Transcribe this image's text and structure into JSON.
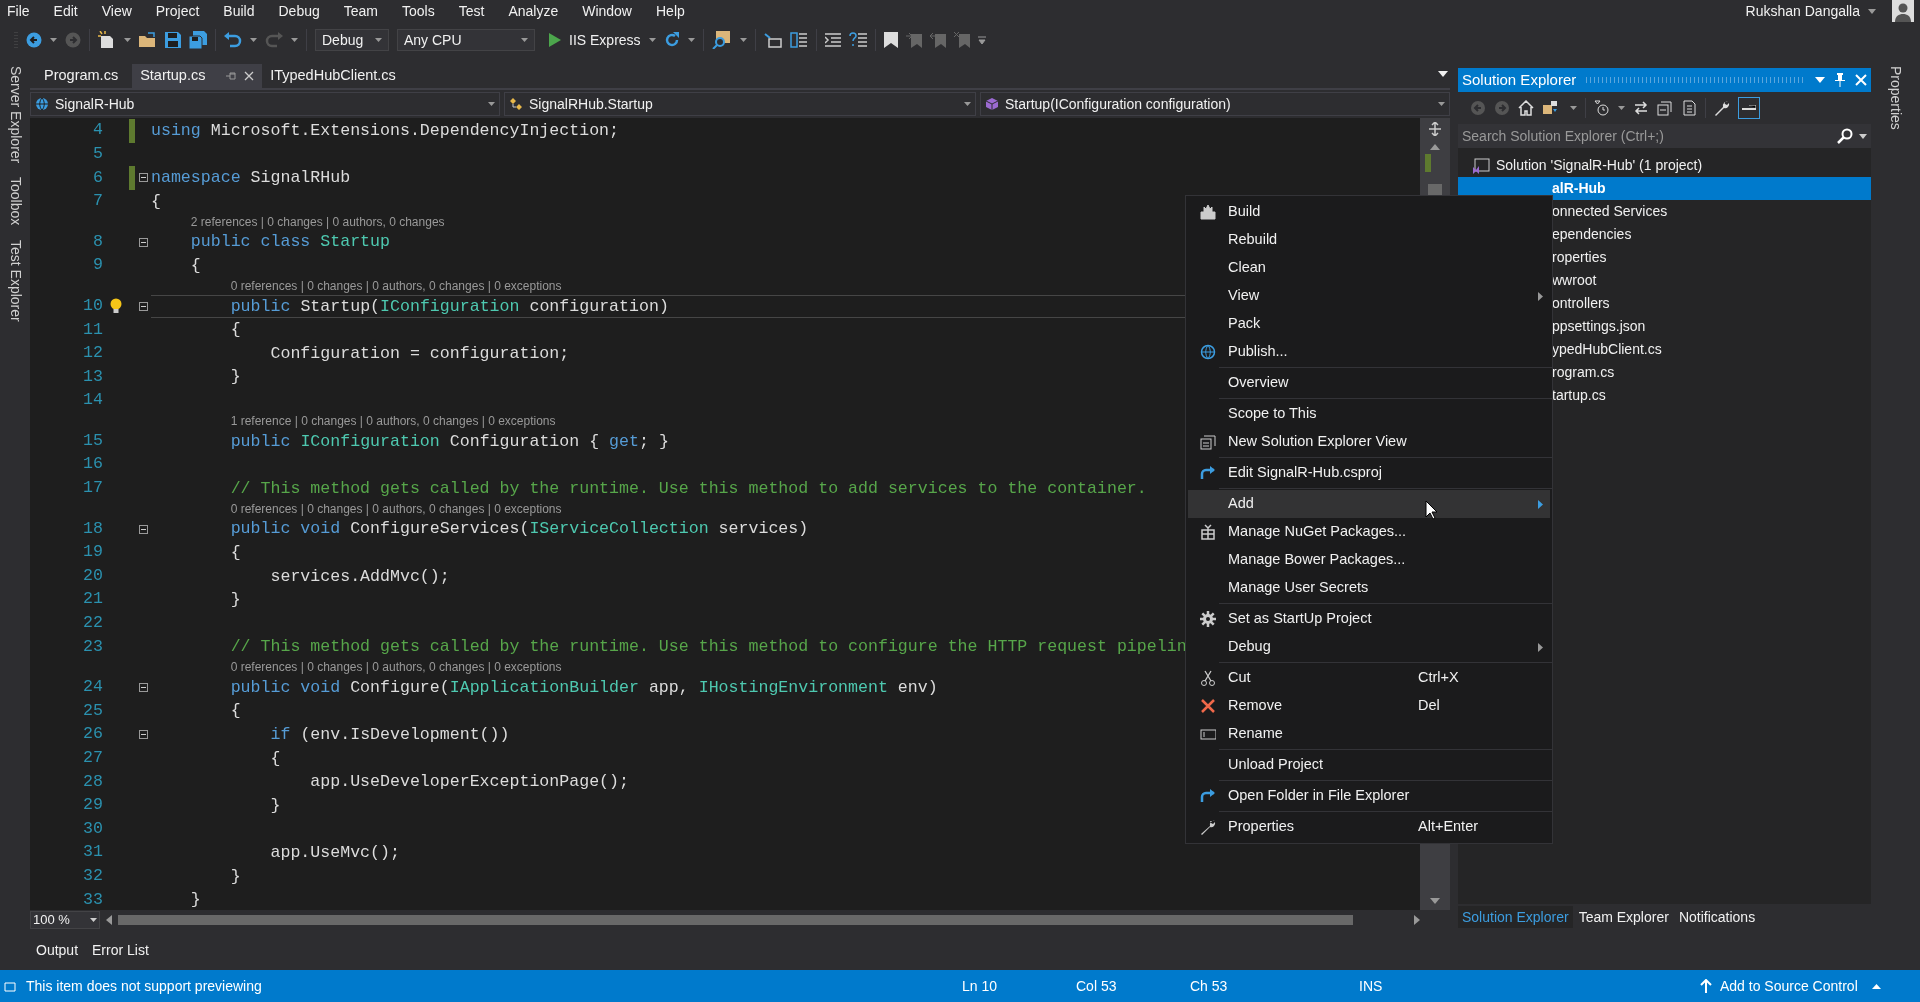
{
  "menu_bar": [
    "File",
    "Edit",
    "View",
    "Project",
    "Build",
    "Debug",
    "Team",
    "Tools",
    "Test",
    "Analyze",
    "Window",
    "Help"
  ],
  "user": {
    "name": "Rukshan Dangalla"
  },
  "toolbar": {
    "configuration": "Debug",
    "platform": "Any CPU",
    "run_target": "IIS Express"
  },
  "side_tabs_left": [
    "Server Explorer",
    "Toolbox",
    "Test Explorer"
  ],
  "side_tabs_right": [
    "Properties"
  ],
  "editor_tabs": [
    {
      "label": "Program.cs",
      "selected": false
    },
    {
      "label": "Startup.cs",
      "selected": true
    },
    {
      "label": "ITypedHubClient.cs",
      "selected": false
    }
  ],
  "navigation_bar": {
    "project": "SignalR-Hub",
    "type": "SignalRHub.Startup",
    "member": "Startup(IConfiguration configuration)"
  },
  "code": {
    "lines": [
      {
        "number": "4",
        "current": false,
        "changed": true,
        "fold": false,
        "tokens": [
          {
            "kind": "keyword",
            "text": "using"
          },
          {
            "kind": "plain",
            "text": " Microsoft.Extensions.DependencyInjection;"
          }
        ]
      },
      {
        "number": "5",
        "current": false,
        "changed": false,
        "fold": false
      },
      {
        "number": "6",
        "current": false,
        "changed": true,
        "fold": true,
        "tokens": [
          {
            "kind": "keyword",
            "text": "namespace"
          },
          {
            "kind": "plain",
            "text": " SignalRHub"
          }
        ]
      },
      {
        "number": "7",
        "current": false,
        "changed": false,
        "fold": false,
        "tokens": [
          {
            "kind": "plain",
            "text": "{"
          }
        ]
      },
      {
        "number": "8",
        "current": false,
        "changed": false,
        "fold": true,
        "codelens": "2 references | 0 changes | 0 authors, 0 changes",
        "tokens": [
          {
            "kind": "keyword",
            "text": "    public class"
          },
          {
            "kind": "type",
            "text": " Startup"
          }
        ]
      },
      {
        "number": "9",
        "current": false,
        "changed": false,
        "fold": false,
        "tokens": [
          {
            "kind": "plain",
            "text": "    {"
          }
        ]
      },
      {
        "number": "10",
        "current": true,
        "changed": false,
        "fold": true,
        "codelens": "0 references | 0 changes | 0 authors, 0 changes | 0 exceptions",
        "tokens": [
          {
            "kind": "keyword",
            "text": "        public"
          },
          {
            "kind": "plain",
            "text": " Startup("
          },
          {
            "kind": "type",
            "text": "IConfiguration"
          },
          {
            "kind": "plain",
            "text": " configuration)"
          }
        ]
      },
      {
        "number": "11",
        "current": false,
        "changed": false,
        "fold": false,
        "tokens": [
          {
            "kind": "plain",
            "text": "        {"
          }
        ]
      },
      {
        "number": "12",
        "current": false,
        "changed": false,
        "fold": false,
        "tokens": [
          {
            "kind": "plain",
            "text": "            Configuration = configuration;"
          }
        ]
      },
      {
        "number": "13",
        "current": false,
        "changed": false,
        "fold": false,
        "tokens": [
          {
            "kind": "plain",
            "text": "        }"
          }
        ]
      },
      {
        "number": "14",
        "current": false,
        "changed": false,
        "fold": false
      },
      {
        "number": "15",
        "current": false,
        "changed": false,
        "fold": false,
        "codelens": "1 reference | 0 changes | 0 authors, 0 changes | 0 exceptions",
        "tokens": [
          {
            "kind": "keyword",
            "text": "        public"
          },
          {
            "kind": "type",
            "text": " IConfiguration"
          },
          {
            "kind": "plain",
            "text": " Configuration { "
          },
          {
            "kind": "keyword",
            "text": "get"
          },
          {
            "kind": "plain",
            "text": "; }"
          }
        ]
      },
      {
        "number": "16",
        "current": false,
        "changed": false,
        "fold": false
      },
      {
        "number": "17",
        "current": false,
        "changed": false,
        "fold": false,
        "tokens": [
          {
            "kind": "comment",
            "text": "        // This method gets called by the runtime. Use this method to add services to the container."
          }
        ]
      },
      {
        "number": "18",
        "current": false,
        "changed": false,
        "fold": true,
        "codelens": "0 references | 0 changes | 0 authors, 0 changes | 0 exceptions",
        "tokens": [
          {
            "kind": "keyword",
            "text": "        public void"
          },
          {
            "kind": "plain",
            "text": " ConfigureServices("
          },
          {
            "kind": "type",
            "text": "IServiceCollection"
          },
          {
            "kind": "plain",
            "text": " services)"
          }
        ]
      },
      {
        "number": "19",
        "current": false,
        "changed": false,
        "fold": false,
        "tokens": [
          {
            "kind": "plain",
            "text": "        {"
          }
        ]
      },
      {
        "number": "20",
        "current": false,
        "changed": false,
        "fold": false,
        "tokens": [
          {
            "kind": "plain",
            "text": "            services.AddMvc();"
          }
        ]
      },
      {
        "number": "21",
        "current": false,
        "changed": false,
        "fold": false,
        "tokens": [
          {
            "kind": "plain",
            "text": "        }"
          }
        ]
      },
      {
        "number": "22",
        "current": false,
        "changed": false,
        "fold": false
      },
      {
        "number": "23",
        "current": false,
        "changed": false,
        "fold": false,
        "tokens": [
          {
            "kind": "comment",
            "text": "        // This method gets called by the runtime. Use this method to configure the HTTP request pipelin"
          }
        ]
      },
      {
        "number": "24",
        "current": false,
        "changed": false,
        "fold": true,
        "codelens": "0 references | 0 changes | 0 authors, 0 changes | 0 exceptions",
        "tokens": [
          {
            "kind": "keyword",
            "text": "        public void"
          },
          {
            "kind": "plain",
            "text": " Configure("
          },
          {
            "kind": "type",
            "text": "IApplicationBuilder"
          },
          {
            "kind": "plain",
            "text": " app, "
          },
          {
            "kind": "type",
            "text": "IHostingEnvironment"
          },
          {
            "kind": "plain",
            "text": " env)"
          }
        ]
      },
      {
        "number": "25",
        "current": false,
        "changed": false,
        "fold": false,
        "tokens": [
          {
            "kind": "plain",
            "text": "        {"
          }
        ]
      },
      {
        "number": "26",
        "current": false,
        "changed": false,
        "fold": true,
        "tokens": [
          {
            "kind": "keyword",
            "text": "            if"
          },
          {
            "kind": "plain",
            "text": " (env.IsDevelopment())"
          }
        ]
      },
      {
        "number": "27",
        "current": false,
        "changed": false,
        "fold": false,
        "tokens": [
          {
            "kind": "plain",
            "text": "            {"
          }
        ]
      },
      {
        "number": "28",
        "current": false,
        "changed": false,
        "fold": false,
        "tokens": [
          {
            "kind": "plain",
            "text": "                app.UseDeveloperExceptionPage();"
          }
        ]
      },
      {
        "number": "29",
        "current": false,
        "changed": false,
        "fold": false,
        "tokens": [
          {
            "kind": "plain",
            "text": "            }"
          }
        ]
      },
      {
        "number": "30",
        "current": false,
        "changed": false,
        "fold": false
      },
      {
        "number": "31",
        "current": false,
        "changed": false,
        "fold": false,
        "tokens": [
          {
            "kind": "plain",
            "text": "            app.UseMvc();"
          }
        ]
      },
      {
        "number": "32",
        "current": false,
        "changed": false,
        "fold": false,
        "tokens": [
          {
            "kind": "plain",
            "text": "        }"
          }
        ]
      },
      {
        "number": "33",
        "current": false,
        "changed": false,
        "fold": false,
        "tokens": [
          {
            "kind": "plain",
            "text": "    }"
          }
        ]
      }
    ]
  },
  "zoom": "100 %",
  "bottom_tabs": [
    {
      "label": "Output",
      "selected": false
    },
    {
      "label": "Error List",
      "selected": false
    }
  ],
  "solution_explorer": {
    "title": "Solution Explorer",
    "search": {
      "placeholder": "Search Solution Explorer (Ctrl+;)"
    },
    "solution": "Solution 'SignalR-Hub' (1 project)",
    "items": [
      {
        "label": "alR-Hub",
        "selected": true
      },
      {
        "label": "onnected Services",
        "selected": false
      },
      {
        "label": "ependencies",
        "selected": false
      },
      {
        "label": "roperties",
        "selected": false
      },
      {
        "label": "wwroot",
        "selected": false
      },
      {
        "label": "ontrollers",
        "selected": false
      },
      {
        "label": "ppsettings.json",
        "selected": false
      },
      {
        "label": "ypedHubClient.cs",
        "selected": false
      },
      {
        "label": "rogram.cs",
        "selected": false
      },
      {
        "label": "tartup.cs",
        "selected": false
      }
    ],
    "tabs": [
      {
        "label": "Solution Explorer",
        "selected": true
      },
      {
        "label": "Team Explorer",
        "selected": false
      },
      {
        "label": "Notifications",
        "selected": false
      }
    ]
  },
  "context_menu": [
    {
      "kind": "item",
      "label": "Build",
      "submenu": false,
      "selected": false
    },
    {
      "kind": "item",
      "label": "Rebuild",
      "submenu": false,
      "selected": false
    },
    {
      "kind": "item",
      "label": "Clean",
      "submenu": false,
      "selected": false
    },
    {
      "kind": "item",
      "label": "View",
      "submenu": true,
      "selected": false
    },
    {
      "kind": "item",
      "label": "Pack",
      "submenu": false,
      "selected": false
    },
    {
      "kind": "item",
      "label": "Publish...",
      "submenu": false,
      "selected": false
    },
    {
      "kind": "separator"
    },
    {
      "kind": "item",
      "label": "Overview",
      "submenu": false,
      "selected": false
    },
    {
      "kind": "separator"
    },
    {
      "kind": "item",
      "label": "Scope to This",
      "submenu": false,
      "selected": false
    },
    {
      "kind": "item",
      "label": "New Solution Explorer View",
      "submenu": false,
      "selected": false
    },
    {
      "kind": "separator"
    },
    {
      "kind": "item",
      "label": "Edit SignalR-Hub.csproj",
      "submenu": false,
      "selected": false
    },
    {
      "kind": "separator"
    },
    {
      "kind": "item",
      "label": "Add",
      "submenu": true,
      "selected": true
    },
    {
      "kind": "item",
      "label": "Manage NuGet Packages...",
      "submenu": false,
      "selected": false
    },
    {
      "kind": "item",
      "label": "Manage Bower Packages...",
      "submenu": false,
      "selected": false
    },
    {
      "kind": "item",
      "label": "Manage User Secrets",
      "submenu": false,
      "selected": false
    },
    {
      "kind": "separator"
    },
    {
      "kind": "item",
      "label": "Set as StartUp Project",
      "submenu": false,
      "selected": false
    },
    {
      "kind": "item",
      "label": "Debug",
      "submenu": true,
      "selected": false
    },
    {
      "kind": "separator"
    },
    {
      "kind": "item",
      "label": "Cut",
      "shortcut": "Ctrl+X",
      "submenu": false,
      "selected": false
    },
    {
      "kind": "item",
      "label": "Remove",
      "shortcut": "Del",
      "submenu": false,
      "selected": false
    },
    {
      "kind": "item",
      "label": "Rename",
      "submenu": false,
      "selected": false
    },
    {
      "kind": "separator"
    },
    {
      "kind": "item",
      "label": "Unload Project",
      "submenu": false,
      "selected": false
    },
    {
      "kind": "separator"
    },
    {
      "kind": "item",
      "label": "Open Folder in File Explorer",
      "submenu": false,
      "selected": false
    },
    {
      "kind": "separator"
    },
    {
      "kind": "item",
      "label": "Properties",
      "shortcut": "Alt+Enter",
      "submenu": false,
      "selected": false
    }
  ],
  "status_bar": {
    "message": "This item does not support previewing",
    "line": "Ln 10",
    "column": "Col 53",
    "char": "Ch 53",
    "mode": "INS",
    "source_control": "Add to Source Control"
  }
}
